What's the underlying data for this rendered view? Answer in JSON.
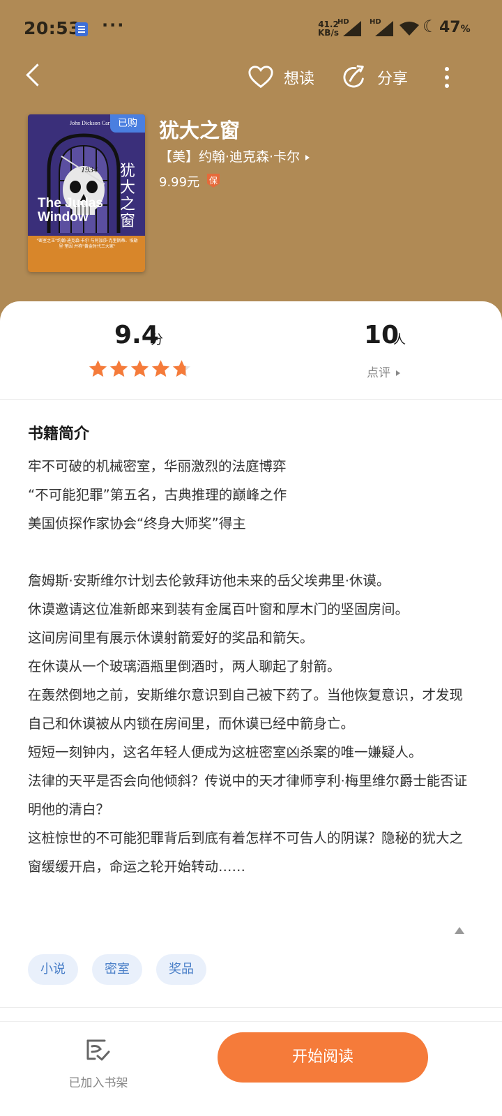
{
  "status_bar": {
    "time": "20:53",
    "more": "···",
    "net_speed_value": "41.2",
    "net_speed_unit": "KB/s",
    "hd1": "HD",
    "hd2": "HD",
    "battery": "47",
    "battery_unit": "%"
  },
  "nav": {
    "want_read_label": "想读",
    "share_label": "分享"
  },
  "book": {
    "title": "犹大之窗",
    "author": "【美】约翰·迪克森·卡尔",
    "price": "9.99元",
    "guarantee_badge": "保",
    "purchased_badge": "已购",
    "cover": {
      "author_en": "John Dickson Carr",
      "title_en": "The Judas Window",
      "title_cn": "犹大之窗",
      "year": "1934",
      "blurb": "\"密室之王\"约翰·迪克森·卡尔 与阿加莎·克里斯蒂、埃勒里·奎因 并称\"黄金时代三大家\""
    }
  },
  "rating": {
    "score": "9.4",
    "score_unit": "分",
    "stars": 4.7,
    "max_stars": 5,
    "review_count": "10",
    "review_unit": "人",
    "review_link": "点评"
  },
  "intro": {
    "title": "书籍简介",
    "paragraphs": [
      "牢不可破的机械密室，华丽激烈的法庭博弈",
      "“不可能犯罪”第五名，古典推理的巅峰之作",
      "美国侦探作家协会“终身大师奖”得主",
      "",
      "詹姆斯·安斯维尔计划去伦敦拜访他未来的岳父埃弗里·休谟。",
      "休谟邀请这位准新郎来到装有金属百叶窗和厚木门的坚固房间。",
      "这间房间里有展示休谟射箭爱好的奖品和箭矢。",
      "在休谟从一个玻璃酒瓶里倒酒时，两人聊起了射箭。",
      "在轰然倒地之前，安斯维尔意识到自己被下药了。当他恢复意识，才发现自己和休谟被从内锁在房间里，而休谟已经中箭身亡。",
      "短短一刻钟内，这名年轻人便成为这桩密室凶杀案的唯一嫌疑人。",
      "法律的天平是否会向他倾斜？传说中的天才律师亨利·梅里维尔爵士能否证明他的清白？",
      "这桩惊世的不可能犯罪背后到底有着怎样不可告人的阴谋？隐秘的犹大之窗缓缓开启，命运之轮开始转动……"
    ]
  },
  "tags": [
    "小说",
    "密室",
    "奖品"
  ],
  "bottom": {
    "shelf_label": "已加入书架",
    "start_read_label": "开始阅读"
  },
  "colors": {
    "header_bg": "#b08a55",
    "accent_orange": "#f57b3a",
    "star": "#f57b3a",
    "tag_bg": "#e9f0fb",
    "tag_text": "#4a7fc8",
    "purchased_badge": "#4a7fe0"
  }
}
